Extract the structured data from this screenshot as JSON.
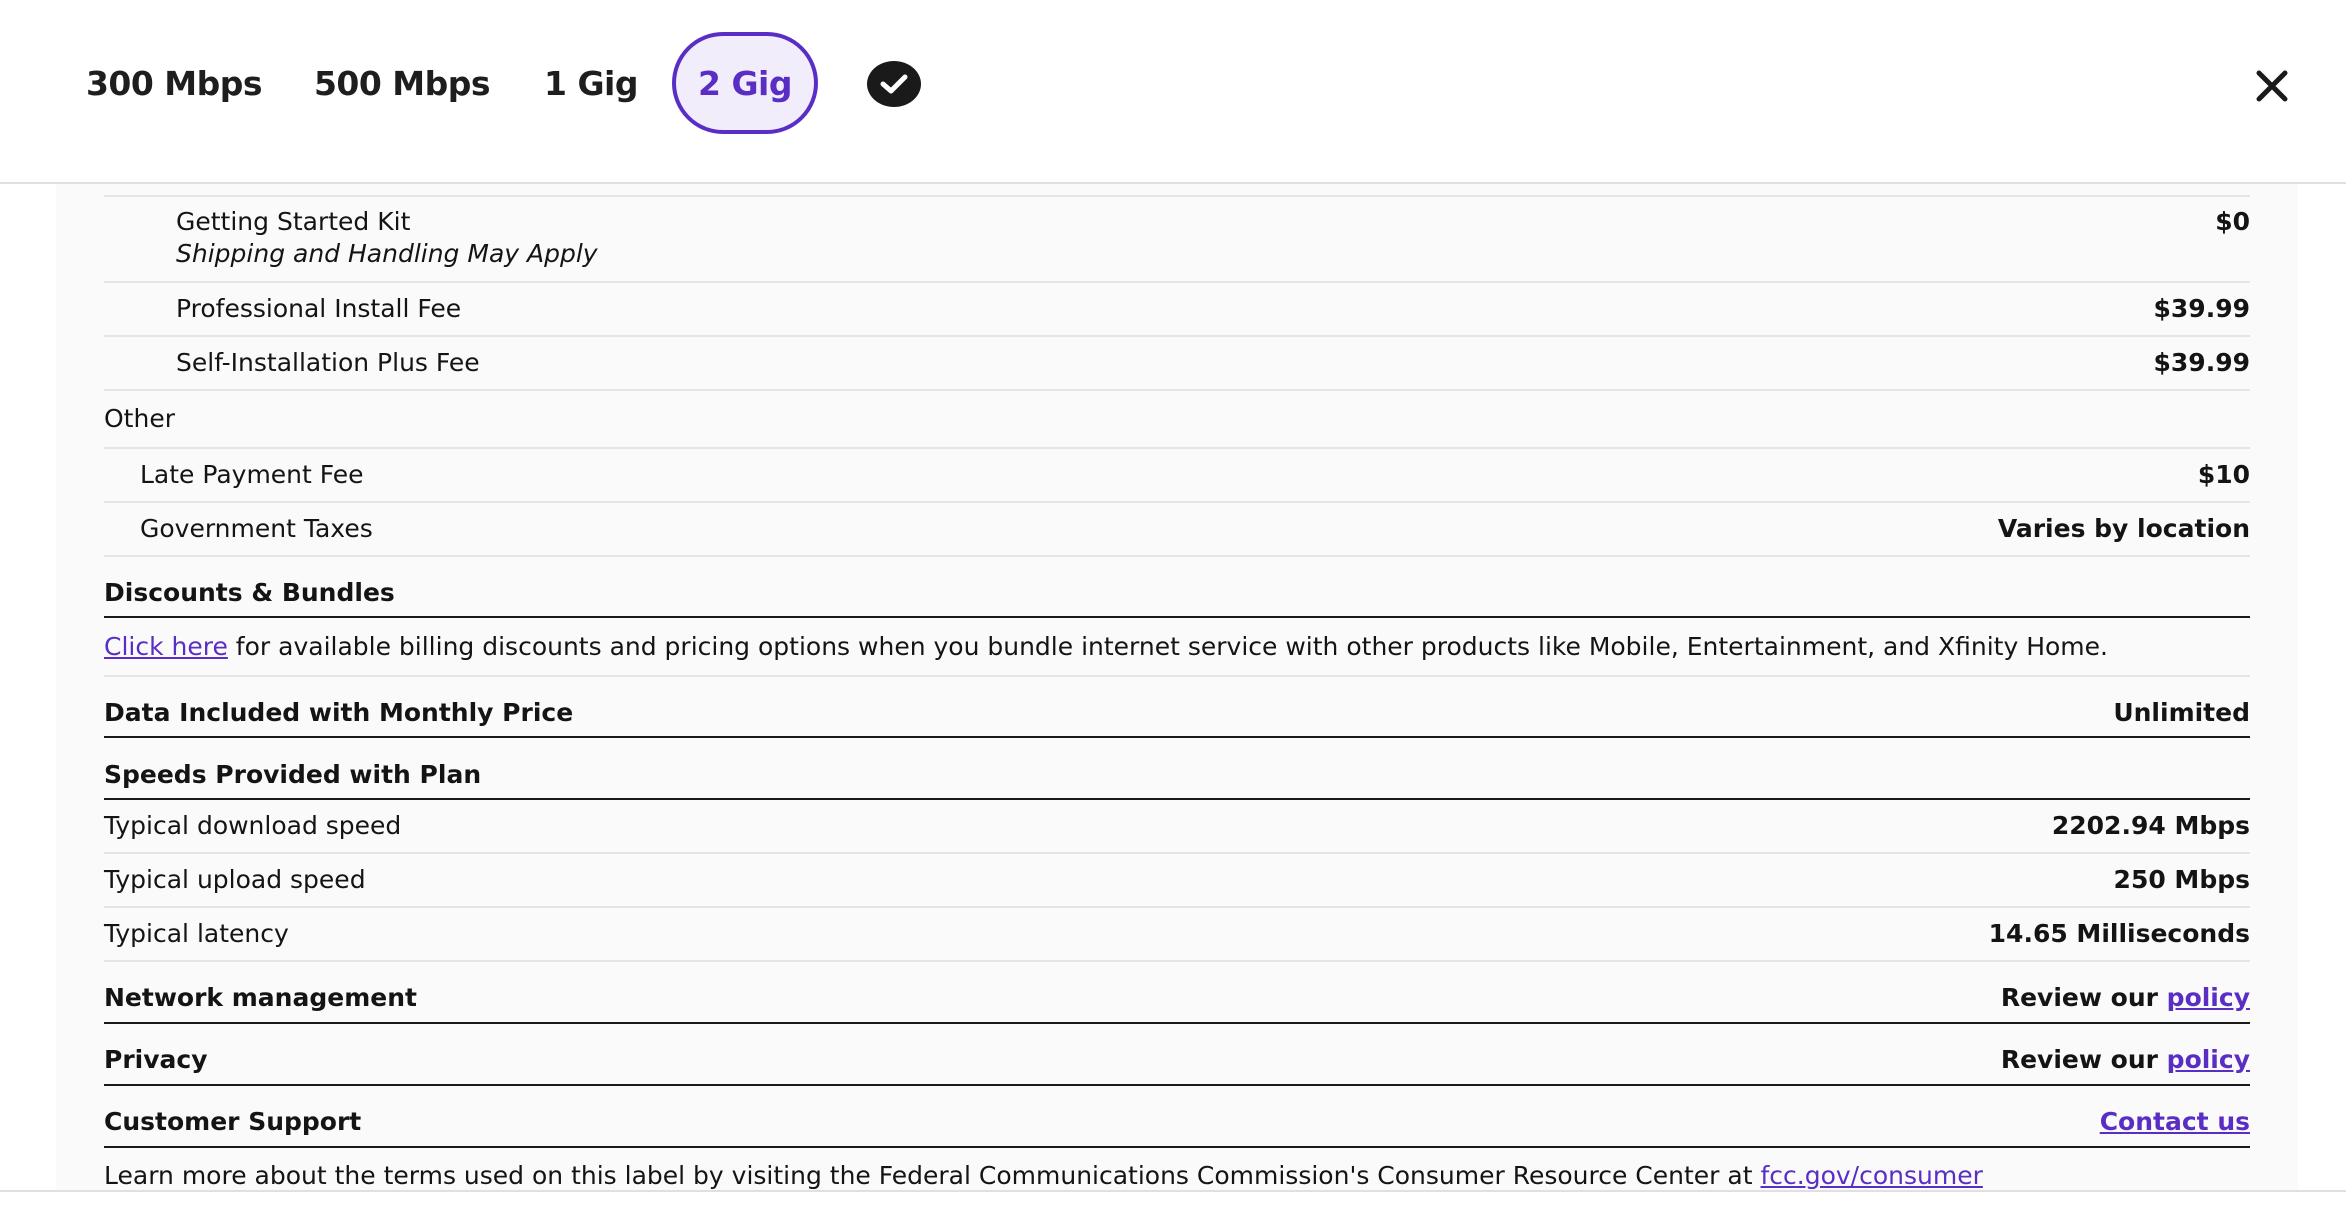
{
  "tabs": [
    {
      "label": "300 Mbps",
      "active": false
    },
    {
      "label": "500 Mbps",
      "active": false
    },
    {
      "label": "1 Gig",
      "active": false
    },
    {
      "label": "2 Gig",
      "active": true
    }
  ],
  "equipment": {
    "kit_label": "Getting Started Kit",
    "kit_note": "Shipping and Handling May Apply",
    "kit_value": "$0",
    "install_label": "Professional Install Fee",
    "install_value": "$39.99",
    "self_label": "Self-Installation Plus Fee",
    "self_value": "$39.99"
  },
  "other": {
    "title": "Other",
    "late_label": "Late Payment Fee",
    "late_value": "$10",
    "tax_label": "Government Taxes",
    "tax_value": "Varies by location"
  },
  "discounts": {
    "title": "Discounts & Bundles",
    "link": "Click here",
    "text": " for available billing discounts and pricing options when you bundle internet service with other products like Mobile, Entertainment, and Xfinity Home."
  },
  "data_included": {
    "label": "Data Included with Monthly Price",
    "value": "Unlimited"
  },
  "speeds": {
    "title": "Speeds Provided with Plan",
    "download_label": "Typical download speed",
    "download_value": "2202.94 Mbps",
    "upload_label": "Typical upload speed",
    "upload_value": "250 Mbps",
    "latency_label": "Typical latency",
    "latency_value": "14.65 Milliseconds"
  },
  "network": {
    "label": "Network management",
    "prefix": "Review our ",
    "link": "policy"
  },
  "privacy": {
    "label": "Privacy",
    "prefix": "Review our ",
    "link": "policy"
  },
  "support": {
    "label": "Customer Support",
    "link": "Contact us"
  },
  "footer": {
    "text": "Learn more about the terms used on this label by visiting the Federal Communications Commission's Consumer Resource Center at ",
    "link": "fcc.gov/consumer"
  },
  "colors": {
    "accent": "#5a2ec4",
    "active_tab_bg": "#f1edfb",
    "text": "#141414"
  }
}
